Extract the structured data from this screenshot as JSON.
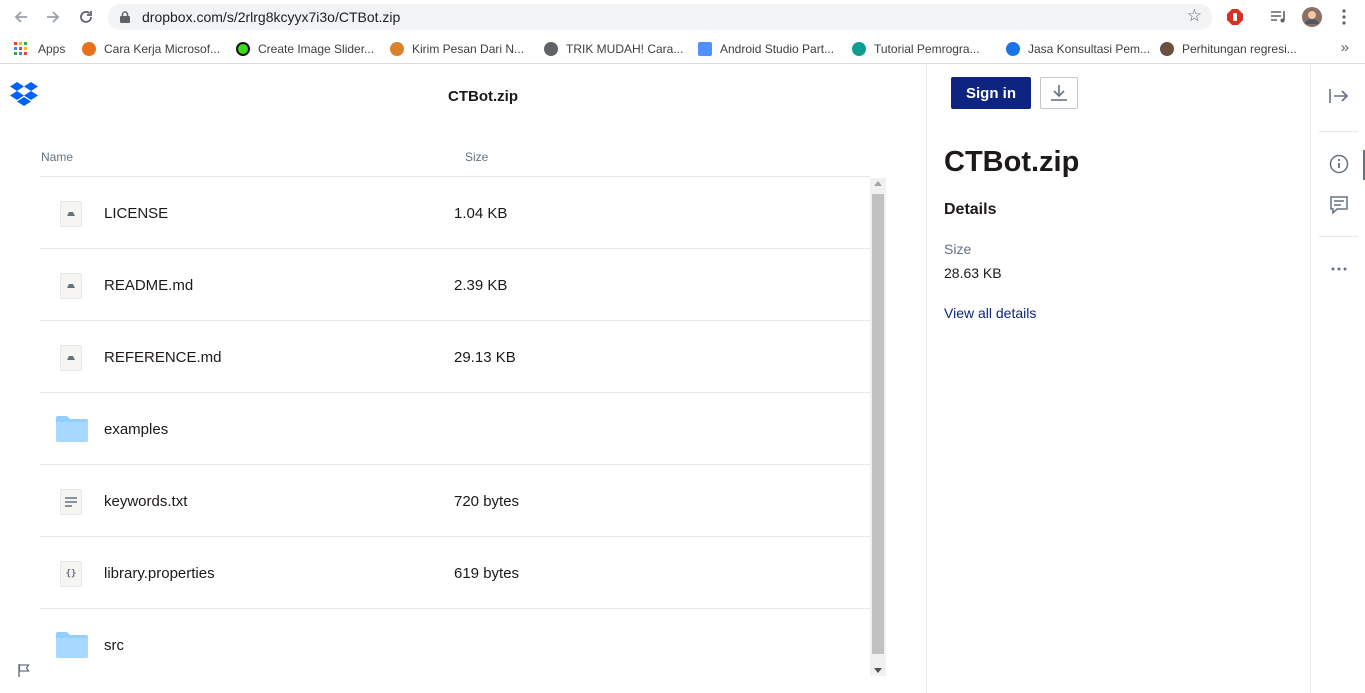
{
  "browser": {
    "url": "dropbox.com/s/2rlrg8kcyyx7i3o/CTBot.zip",
    "bookmarks": [
      {
        "label": "Apps",
        "color": "#ea4335"
      },
      {
        "label": "Cara Kerja Microsof...",
        "color": "#e8711c"
      },
      {
        "label": "Create Image Slider...",
        "color": "#3ddc1a"
      },
      {
        "label": "Kirim Pesan Dari N...",
        "color": "#d9822b"
      },
      {
        "label": "TRIK MUDAH! Cara...",
        "color": "#5f6368"
      },
      {
        "label": "Android Studio Part...",
        "color": "#4d90fe"
      },
      {
        "label": "Tutorial Pemrogra...",
        "color": "#0f9d8e"
      },
      {
        "label": "Jasa Konsultasi Pem...",
        "color": "#1a73e8"
      },
      {
        "label": "Perhitungan regresi...",
        "color": "#6b4f3f"
      }
    ]
  },
  "main": {
    "title": "CTBot.zip",
    "columns": {
      "name": "Name",
      "size": "Size"
    },
    "files": [
      {
        "name": "LICENSE",
        "size": "1.04 KB",
        "icon": "document-icon"
      },
      {
        "name": "README.md",
        "size": "2.39 KB",
        "icon": "document-icon"
      },
      {
        "name": "REFERENCE.md",
        "size": "29.13 KB",
        "icon": "document-icon"
      },
      {
        "name": "examples",
        "size": "",
        "icon": "folder-icon"
      },
      {
        "name": "keywords.txt",
        "size": "720 bytes",
        "icon": "text-file-icon"
      },
      {
        "name": "library.properties",
        "size": "619 bytes",
        "icon": "code-file-icon"
      },
      {
        "name": "src",
        "size": "",
        "icon": "folder-icon"
      }
    ]
  },
  "panel": {
    "signin_label": "Sign in",
    "title": "CTBot.zip",
    "details_heading": "Details",
    "size_label": "Size",
    "size_value": "28.63 KB",
    "view_all_label": "View all details"
  },
  "colors": {
    "brand": "#0061fe",
    "signin_bg": "#0d2481",
    "folder": "#92ceff"
  }
}
